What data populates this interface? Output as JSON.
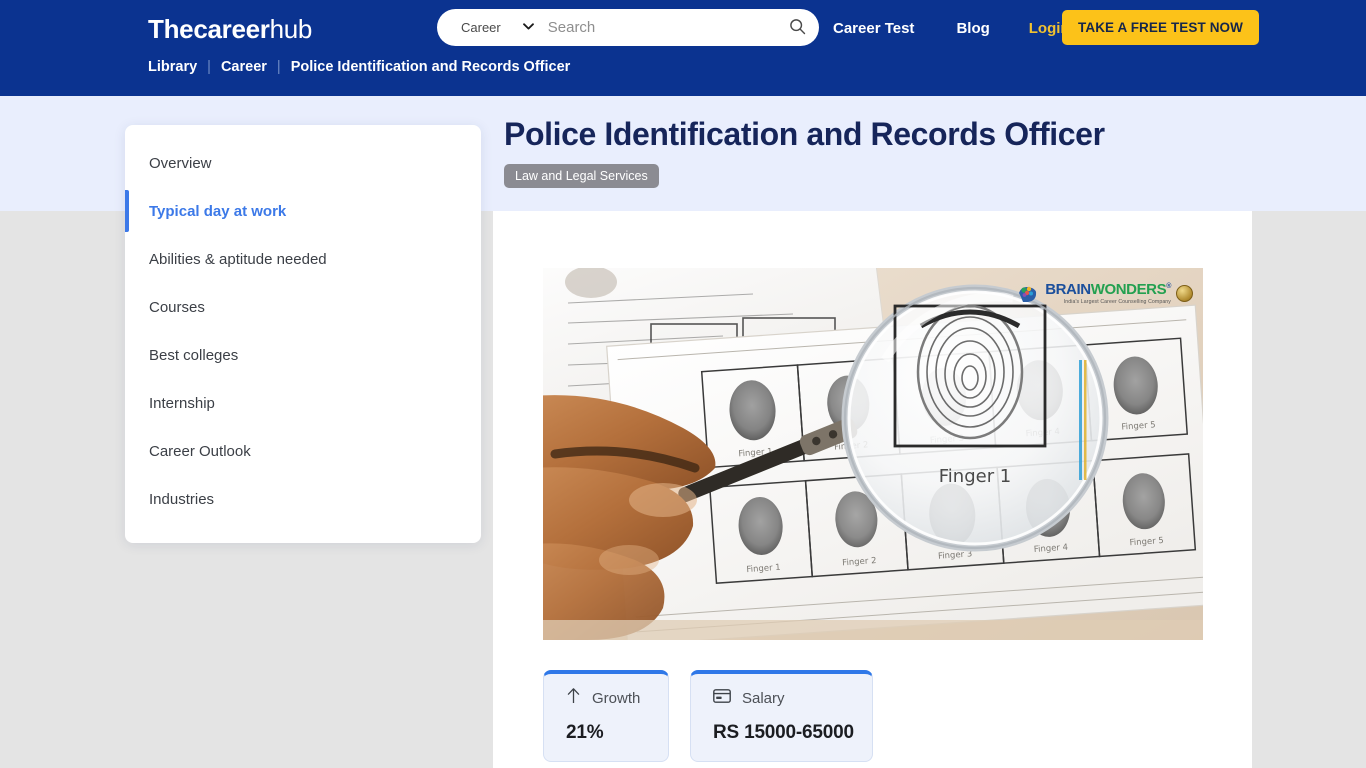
{
  "header": {
    "brand_bold": "Thecareer",
    "brand_light": "hub",
    "search": {
      "category": "Career",
      "placeholder": "Search",
      "value": "",
      "caret": "⌄",
      "search_icon": "search-icon"
    },
    "nav": [
      {
        "label": "Career Test",
        "style": "white"
      },
      {
        "label": "Blog",
        "style": "white"
      },
      {
        "label": "Login",
        "style": "gold"
      }
    ],
    "cta_label": "TAKE A FREE TEST NOW",
    "breadcrumb": {
      "items": [
        "Library",
        "Career",
        "Police Identification and Records Officer"
      ],
      "separator": "|"
    },
    "colors": {
      "bar": "#0b3390",
      "cta": "#fcc219",
      "login": "#f2c230"
    }
  },
  "hero": {
    "title": "Police Identification and Records Officer",
    "badge": "Law and Legal Services",
    "colors": {
      "background": "#e9eefd",
      "title": "#16255a",
      "badge": "#8b8b92"
    }
  },
  "sidebar": {
    "items": [
      {
        "label": "Overview",
        "active": false
      },
      {
        "label": "Typical day at work",
        "active": true
      },
      {
        "label": "Abilities & aptitude needed",
        "active": false
      },
      {
        "label": "Courses",
        "active": false
      },
      {
        "label": "Best colleges",
        "active": false
      },
      {
        "label": "Internship",
        "active": false
      },
      {
        "label": "Career Outlook",
        "active": false
      },
      {
        "label": "Industries",
        "active": false
      }
    ],
    "accent_color": "#3c79e8"
  },
  "main": {
    "photo": {
      "alt": "Hand holding a magnifying glass over a fingerprint record card",
      "card_labels_row1": [
        "Finger 1",
        "Finger 2",
        "Finger 3",
        "Finger 4",
        "Finger 5"
      ],
      "card_labels_row2": [
        "Finger 1",
        "Finger 2",
        "Finger 3",
        "Finger 4",
        "Finger 5"
      ],
      "magnified_label": "Finger 1",
      "watermark": {
        "brand_part1": "BRAIN",
        "brand_part2": "WONDERS",
        "registered": "®",
        "tagline": "India's Largest Career Counselling Company"
      }
    },
    "stats": [
      {
        "icon": "arrow-up-icon",
        "label": "Growth",
        "value": "21%"
      },
      {
        "icon": "credit-card-icon",
        "label": "Salary",
        "value": "RS 15000-65000"
      }
    ],
    "accent_color": "#2f78e8"
  }
}
